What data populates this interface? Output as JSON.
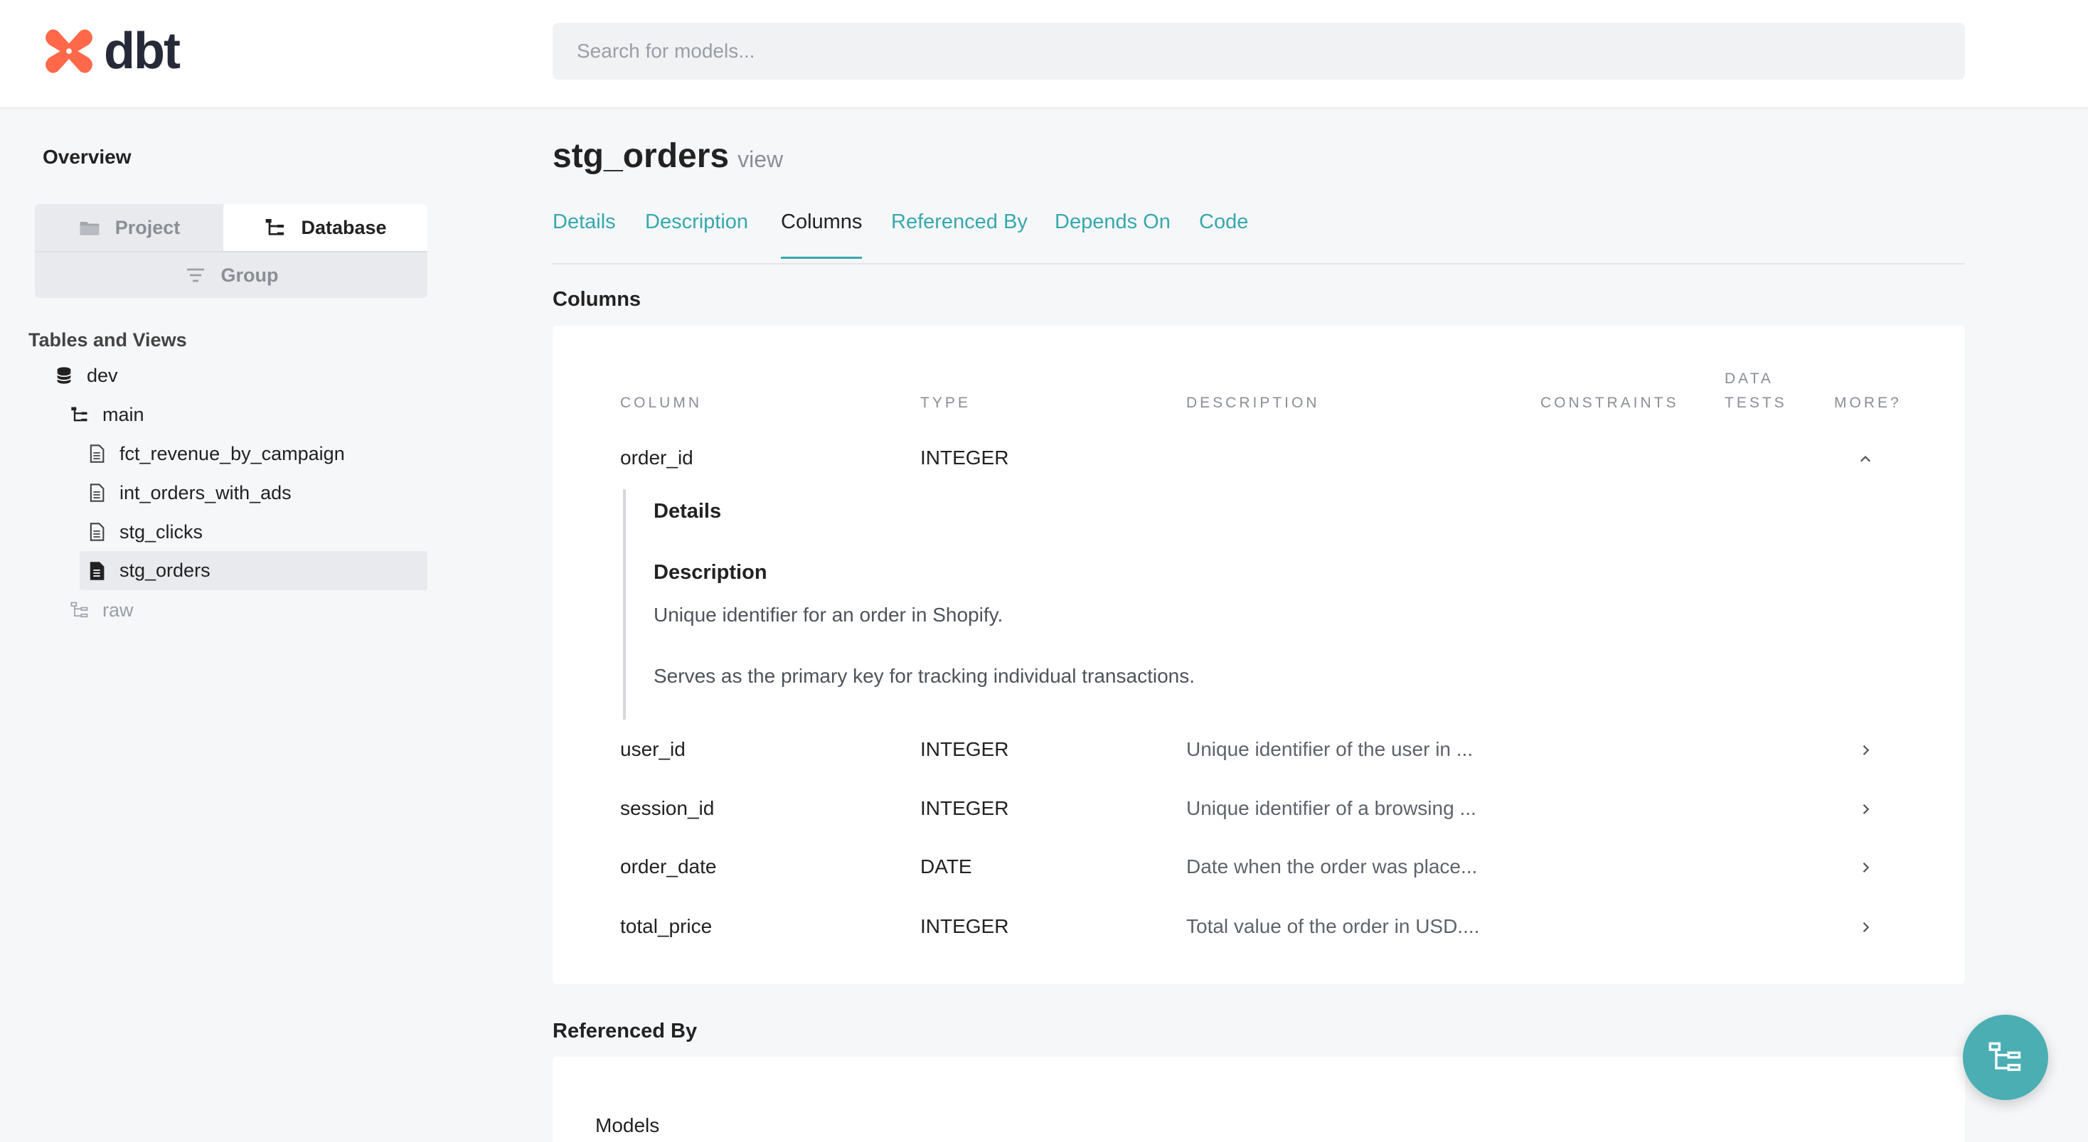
{
  "header": {
    "logo_text": "dbt",
    "search_placeholder": "Search for models..."
  },
  "sidebar": {
    "overview": "Overview",
    "switch": {
      "project": "Project",
      "database": "Database",
      "group": "Group"
    },
    "tables_title": "Tables and Views",
    "tree": {
      "db": "dev",
      "schema_main": "main",
      "models": [
        "fct_revenue_by_campaign",
        "int_orders_with_ads",
        "stg_clicks",
        "stg_orders"
      ],
      "schema_raw": "raw"
    }
  },
  "model": {
    "name": "stg_orders",
    "kind": "view"
  },
  "tabs": [
    "Details",
    "Description",
    "Columns",
    "Referenced By",
    "Depends On",
    "Code"
  ],
  "active_tab": "Columns",
  "columns_section": {
    "title": "Columns",
    "headers": {
      "column": "COLUMN",
      "type": "TYPE",
      "description": "DESCRIPTION",
      "constraints": "CONSTRAINTS",
      "data_tests_1": "DATA",
      "data_tests_2": "TESTS",
      "more": "MORE?"
    },
    "rows": [
      {
        "name": "order_id",
        "type": "INTEGER",
        "description": ""
      },
      {
        "name": "user_id",
        "type": "INTEGER",
        "description": "Unique identifier of the user in ..."
      },
      {
        "name": "session_id",
        "type": "INTEGER",
        "description": "Unique identifier of a browsing ..."
      },
      {
        "name": "order_date",
        "type": "DATE",
        "description": "Date when the order was place..."
      },
      {
        "name": "total_price",
        "type": "INTEGER",
        "description": "Total value of the order in USD...."
      }
    ],
    "expanded": {
      "details_title": "Details",
      "description_title": "Description",
      "line1": "Unique identifier for an order in Shopify.",
      "line2": "Serves as the primary key for tracking individual transactions."
    }
  },
  "referenced_by": {
    "title": "Referenced By",
    "models_label": "Models"
  },
  "colors": {
    "accent": "#37a8ad",
    "logo": "#ff694a",
    "fab": "#4aaeb3"
  },
  "icons": {
    "folder": "folder-icon",
    "database": "database-tree-icon",
    "group": "filter-lines-icon",
    "db": "database-cylinder-icon",
    "schema": "schema-tree-icon",
    "file": "document-icon",
    "chevron_up": "chevron-up-icon",
    "chevron_right": "chevron-right-icon",
    "lineage": "lineage-graph-icon"
  }
}
